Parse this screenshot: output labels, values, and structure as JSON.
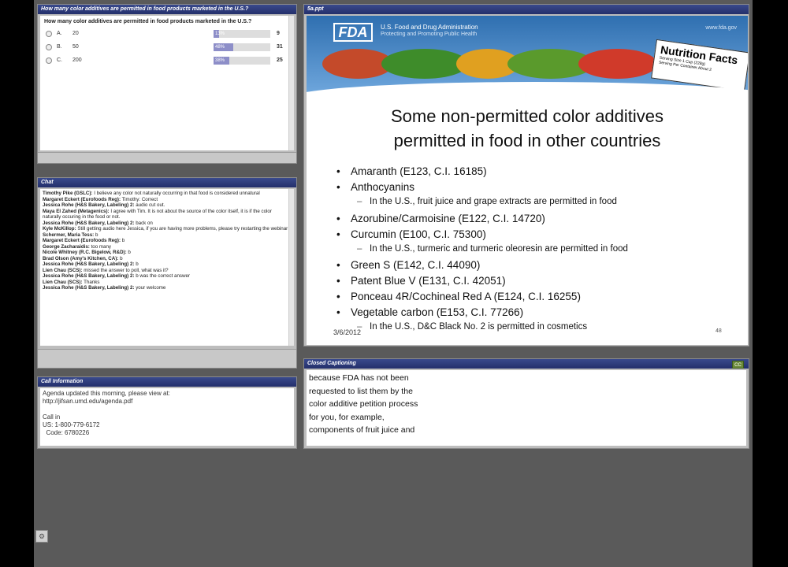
{
  "poll": {
    "title": "How many color additives are permitted in food products marketed in the U.S.?",
    "question": "How many color additives are permitted in food products marketed in the U.S.?",
    "options": [
      {
        "letter": "A.",
        "value": "20",
        "percent_label": "13%",
        "percent": 13,
        "count": "9"
      },
      {
        "letter": "B.",
        "value": "50",
        "percent_label": "48%",
        "percent": 48,
        "count": "31"
      },
      {
        "letter": "C.",
        "value": "200",
        "percent_label": "38%",
        "percent": 38,
        "count": "25"
      }
    ]
  },
  "chat": {
    "title": "Chat",
    "messages": [
      {
        "name": "Timothy Pike (GSLC):",
        "text": " I believe any color not naturally occurring in that food is considered unnatural"
      },
      {
        "name": "Margaret Eckert (Eurofoods Reg):",
        "text": " Timothy:  Correct"
      },
      {
        "name": "Jessica Rohe (H&S Bakery, Labeling) 2:",
        "text": " audio cut out."
      },
      {
        "name": "Maya El Zahed (Metagenics):",
        "text": " I agree with Tim. It is not about the source of the color itself, it is if the color naturally occuring in the food or not."
      },
      {
        "name": "Jessica Rohe (H&S Bakery, Labeling) 2:",
        "text": " back on"
      },
      {
        "name": "Kyle McKillop:",
        "text": " Still getting audio here Jessica, if you are having more problems, please try restarting the webinar"
      },
      {
        "name": "Schermer, Maria Tess:",
        "text": " b"
      },
      {
        "name": "Margaret Eckert (Eurofoods Reg):",
        "text": " b"
      },
      {
        "name": "George Zacharaidis:",
        "text": " too many"
      },
      {
        "name": "Nicole Whitney (R.C. Bigelow, R&D):",
        "text": " b"
      },
      {
        "name": "Brad Olson (Amy's Kitchen, CA):",
        "text": " b"
      },
      {
        "name": "Jessica Rohe (H&S Bakery, Labeling) 2:",
        "text": " b"
      },
      {
        "name": "Lien Chau (SCS):",
        "text": " missed the answer to poll, what was it?"
      },
      {
        "name": "Jessica Rohe (H&S Bakery, Labeling) 2:",
        "text": " b was the correct answer"
      },
      {
        "name": "Lien Chau (SCS):",
        "text": " Thanks"
      },
      {
        "name": "Jessica Rohe (H&S Bakery, Labeling) 2:",
        "text": " your welcome"
      }
    ]
  },
  "callinfo": {
    "title": "Call Information",
    "lines": [
      "Agenda updated this morning, please view at:",
      "http://jifsan.umd.edu/agenda.pdf",
      "",
      "Call in",
      "US: 1-800-779-6172",
      "  Code: 6780226"
    ]
  },
  "slide": {
    "window_title": "5a.ppt",
    "agency": "U.S. Food and Drug Administration",
    "agency_sub": "Protecting and Promoting Public Health",
    "agency_url": "www.fda.gov",
    "logo": "FDA",
    "nutrition_label": "Nutrition Facts",
    "nutrition_sub1": "Serving Size 1 Cup (228g)",
    "nutrition_sub2": "Serving Per Container About 2",
    "title_line1": "Some non-permitted color additives",
    "title_line2": "permitted in food in other countries",
    "bullets": [
      {
        "level": 1,
        "text": "Amaranth (E123, C.I. 16185)"
      },
      {
        "level": 1,
        "text": "Anthocyanins"
      },
      {
        "level": 2,
        "text": "In the U.S., fruit juice and grape extracts are permitted in food"
      },
      {
        "level": 1,
        "text": "Azorubine/Carmoisine (E122, C.I. 14720)"
      },
      {
        "level": 1,
        "text": "Curcumin (E100, C.I. 75300)"
      },
      {
        "level": 2,
        "text": "In the U.S., turmeric and turmeric oleoresin are permitted in food"
      },
      {
        "level": 1,
        "text": "Green S (E142, C.I. 44090)"
      },
      {
        "level": 1,
        "text": "Patent Blue V (E131, C.I. 42051)"
      },
      {
        "level": 1,
        "text": "Ponceau 4R/Cochineal Red A (E124, C.I. 16255)"
      },
      {
        "level": 1,
        "text": "Vegetable carbon (E153, C.I. 77266)"
      },
      {
        "level": 2,
        "text": "In the U.S., D&C Black No. 2 is permitted in cosmetics"
      }
    ],
    "date": "3/6/2012",
    "page_number": "48"
  },
  "captions": {
    "title": "Closed Captioning",
    "cc_label": "CC",
    "lines": [
      "because FDA has not been",
      "requested to list them by the",
      "color additive petition process",
      "for you, for example,",
      "components of fruit juice and"
    ]
  },
  "settings_icon": "gear-icon"
}
